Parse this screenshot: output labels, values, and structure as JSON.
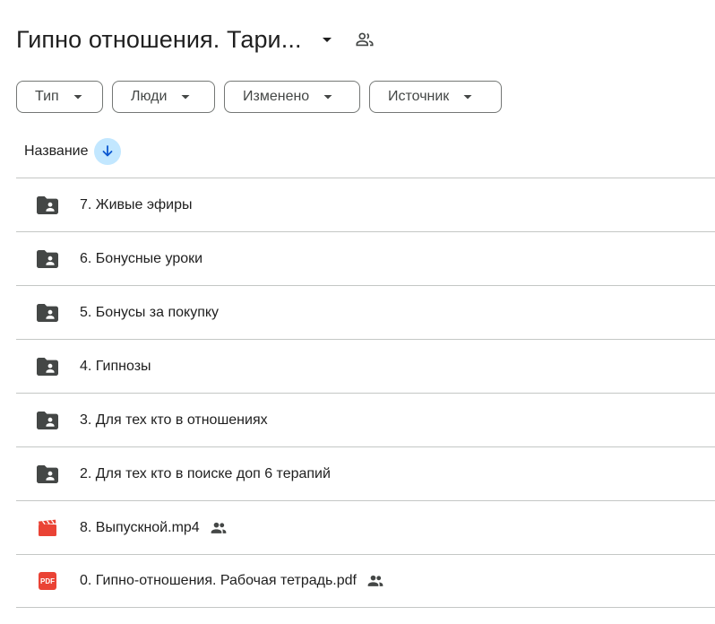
{
  "header": {
    "title": "Гипно отношения. Тари...",
    "caret_icon": "arrow-drop-down-icon",
    "shared_icon": "people-outline-icon"
  },
  "filters": {
    "type": "Тип",
    "people": "Люди",
    "modified": "Изменено",
    "source": "Источник"
  },
  "columns": {
    "name": "Название",
    "sort_icon": "arrow-down-icon"
  },
  "colors": {
    "border": "#c4c7c5",
    "chip_border": "#747775",
    "sort_bg": "#c2e7ff",
    "sort_arrow": "#0b57d0",
    "folder_icon": "#444746",
    "video_icon": "#ea4335",
    "pdf_icon": "#ea4335"
  },
  "files": [
    {
      "name": "7. Живые эфиры",
      "icon": "shared-folder-icon",
      "shared": false
    },
    {
      "name": "6. Бонусные уроки",
      "icon": "shared-folder-icon",
      "shared": false
    },
    {
      "name": "5. Бонусы за покупку",
      "icon": "shared-folder-icon",
      "shared": false
    },
    {
      "name": "4. Гипнозы",
      "icon": "shared-folder-icon",
      "shared": false
    },
    {
      "name": "3. Для тех кто в отношениях",
      "icon": "shared-folder-icon",
      "shared": false
    },
    {
      "name": "2. Для тех кто в поиске доп 6 терапий",
      "icon": "shared-folder-icon",
      "shared": false
    },
    {
      "name": "8. Выпускной.mp4",
      "icon": "video-file-icon",
      "shared": true
    },
    {
      "name": "0. Гипно-отношения. Рабочая тетрадь.pdf",
      "icon": "pdf-file-icon",
      "pdf_label": "PDF",
      "shared": true
    }
  ]
}
